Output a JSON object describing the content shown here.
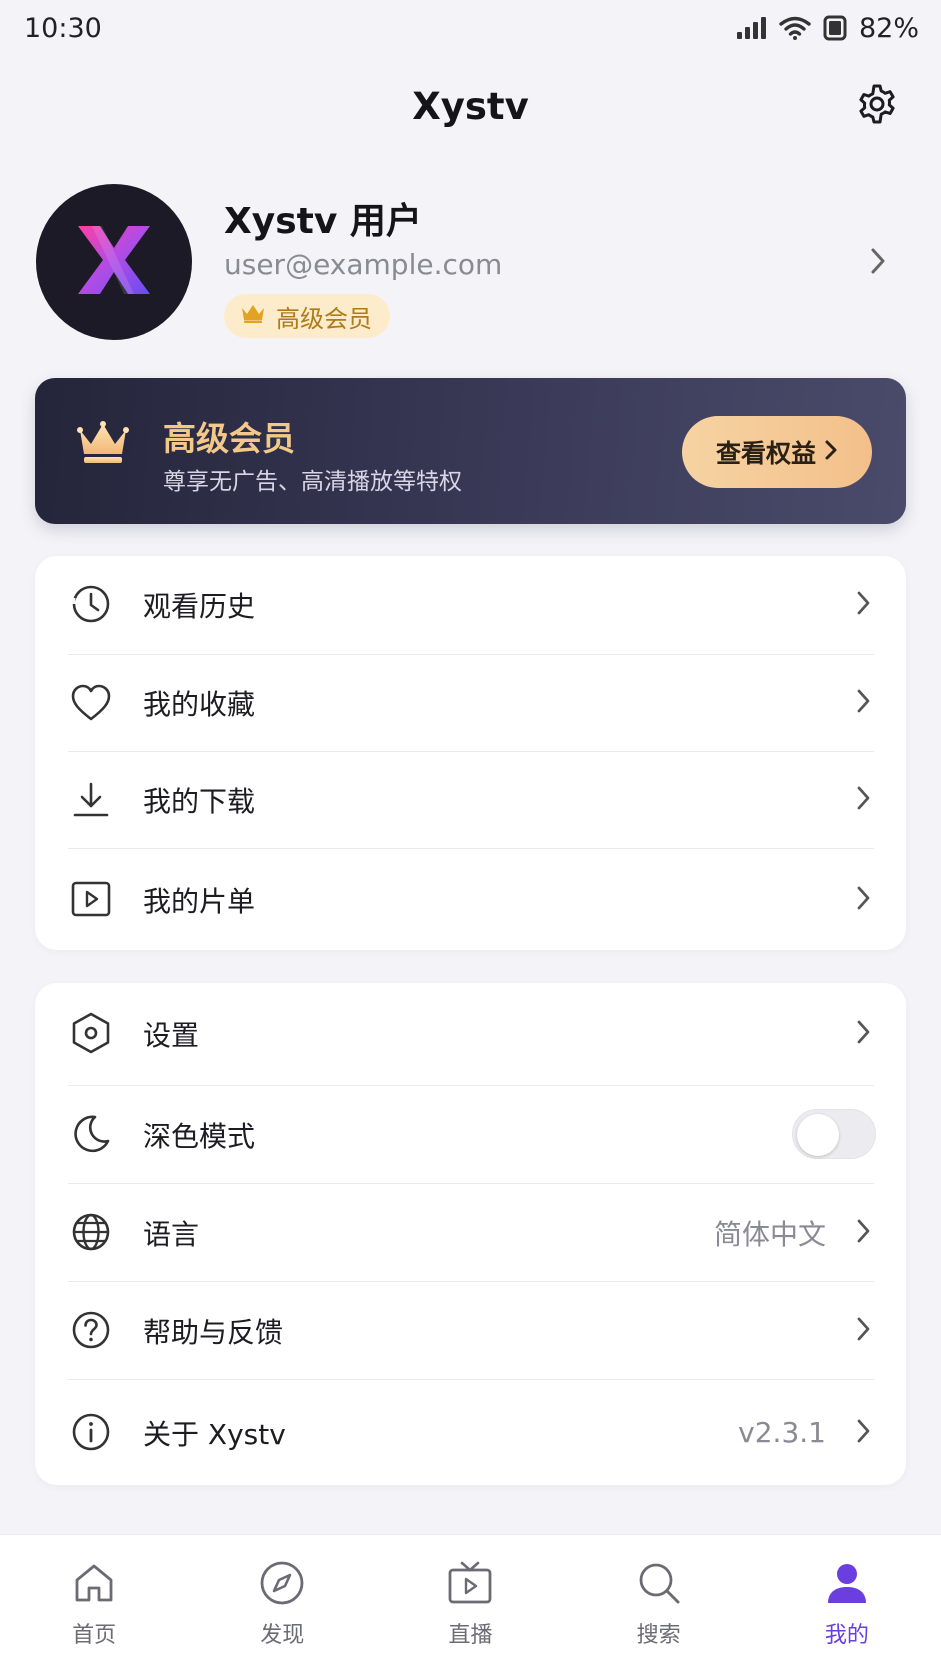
{
  "status_bar": {
    "time": "10:30",
    "battery": "82%"
  },
  "header": {
    "title": "Xystv"
  },
  "profile": {
    "name": "Xystv 用户",
    "email": "user@example.com",
    "badge": "高级会员",
    "avatar_letter": "X"
  },
  "vip_card": {
    "title": "高级会员",
    "subtitle": "尊享无广告、高清播放等特权",
    "button": "查看权益"
  },
  "menu_primary": [
    {
      "label": "观看历史",
      "icon": "clock-icon"
    },
    {
      "label": "我的收藏",
      "icon": "heart-icon"
    },
    {
      "label": "我的下载",
      "icon": "download-icon"
    },
    {
      "label": "我的片单",
      "icon": "playlist-icon"
    }
  ],
  "menu_settings": [
    {
      "label": "设置",
      "icon": "hexagon-settings-icon"
    },
    {
      "label": "深色模式",
      "icon": "moon-icon",
      "toggle": false
    },
    {
      "label": "语言",
      "icon": "globe-icon",
      "value": "简体中文"
    },
    {
      "label": "帮助与反馈",
      "icon": "help-icon"
    },
    {
      "label": "关于 Xystv",
      "icon": "info-icon",
      "value": "v2.3.1"
    }
  ],
  "tabbar": {
    "items": [
      {
        "label": "首页",
        "icon": "home-icon"
      },
      {
        "label": "发现",
        "icon": "compass-icon"
      },
      {
        "label": "直播",
        "icon": "tv-icon"
      },
      {
        "label": "搜索",
        "icon": "search-icon"
      },
      {
        "label": "我的",
        "icon": "user-icon"
      }
    ],
    "active_index": 4
  },
  "colors": {
    "accent": "#6b3ee0",
    "vip_gold": "#f3c98a",
    "vip_card_dark": "#2a2a42",
    "background": "#f4f4f8"
  }
}
